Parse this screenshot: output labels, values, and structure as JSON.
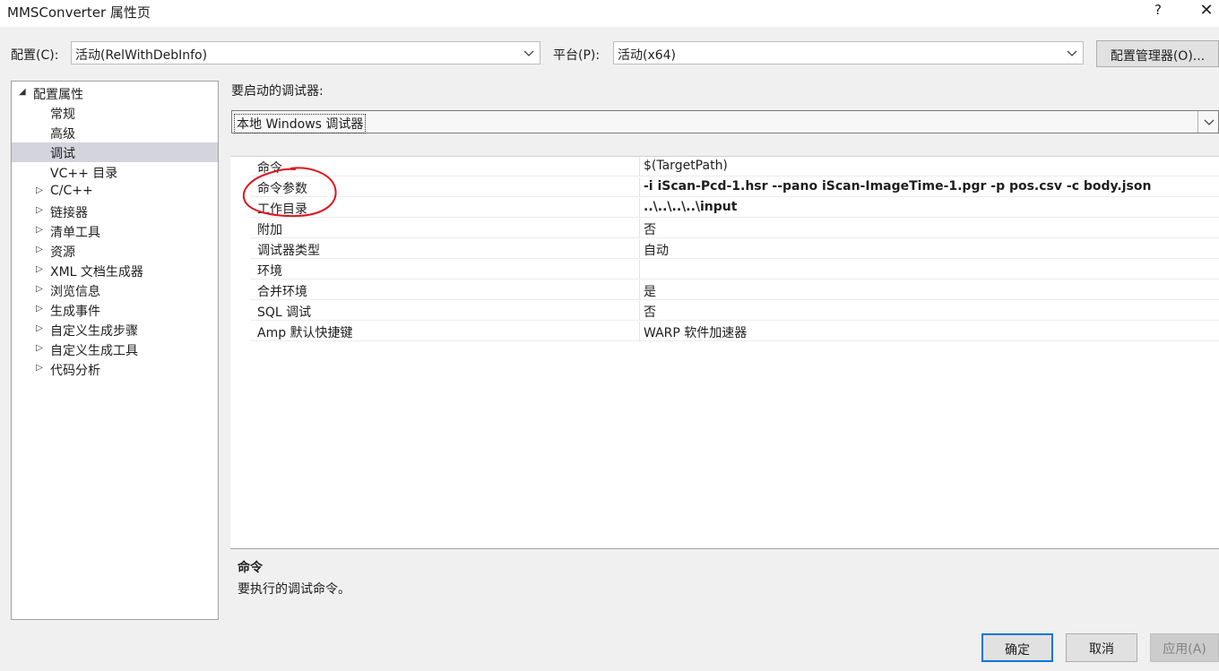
{
  "window": {
    "title": "MMSConverter 属性页",
    "help_label": "?",
    "close_label": "✕"
  },
  "config": {
    "config_label": "配置(C):",
    "config_value": "活动(RelWithDebInfo)",
    "platform_label": "平台(P):",
    "platform_value": "活动(x64)",
    "manager_button": "配置管理器(O)..."
  },
  "tree": {
    "root": "配置属性",
    "items": [
      {
        "label": "常规",
        "expandable": false
      },
      {
        "label": "高级",
        "expandable": false
      },
      {
        "label": "调试",
        "expandable": false,
        "selected": true
      },
      {
        "label": "VC++ 目录",
        "expandable": false
      },
      {
        "label": "C/C++",
        "expandable": true
      },
      {
        "label": "链接器",
        "expandable": true
      },
      {
        "label": "清单工具",
        "expandable": true
      },
      {
        "label": "资源",
        "expandable": true
      },
      {
        "label": "XML 文档生成器",
        "expandable": true
      },
      {
        "label": "浏览信息",
        "expandable": true
      },
      {
        "label": "生成事件",
        "expandable": true
      },
      {
        "label": "自定义生成步骤",
        "expandable": true
      },
      {
        "label": "自定义生成工具",
        "expandable": true
      },
      {
        "label": "代码分析",
        "expandable": true
      }
    ]
  },
  "debugger": {
    "label": "要启动的调试器:",
    "value": "本地 Windows 调试器"
  },
  "properties": [
    {
      "name": "命令",
      "value": "$(TargetPath)",
      "bold": false
    },
    {
      "name": "命令参数",
      "value": "-i iScan-Pcd-1.hsr --pano iScan-ImageTime-1.pgr -p pos.csv -c body.json",
      "bold": true
    },
    {
      "name": "工作目录",
      "value": "..\\..\\..\\..\\input",
      "bold": true
    },
    {
      "name": "附加",
      "value": "否",
      "bold": false
    },
    {
      "name": "调试器类型",
      "value": "自动",
      "bold": false
    },
    {
      "name": "环境",
      "value": "",
      "bold": false
    },
    {
      "name": "合并环境",
      "value": "是",
      "bold": false
    },
    {
      "name": "SQL 调试",
      "value": "否",
      "bold": false
    },
    {
      "name": "Amp 默认快捷键",
      "value": "WARP 软件加速器",
      "bold": false
    }
  ],
  "description": {
    "title": "命令",
    "text": "要执行的调试命令。"
  },
  "buttons": {
    "ok": "确定",
    "cancel": "取消",
    "apply": "应用(A)"
  },
  "colors": {
    "annotation": "#e0141e",
    "selected_tree": "#d4d4dc",
    "default_button_border": "#0078d7"
  }
}
